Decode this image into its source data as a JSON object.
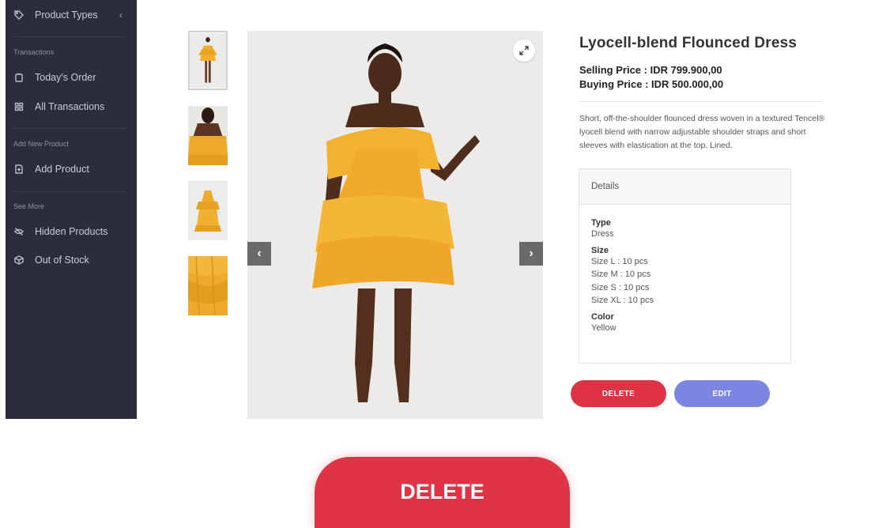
{
  "sidebar": {
    "product_types": "Product Types",
    "sections": {
      "transactions": "Transactions",
      "add_new_product": "Add New Product",
      "see_more": "See More"
    },
    "items": {
      "todays_order": "Today's Order",
      "all_transactions": "All Transactions",
      "add_product": "Add Product",
      "hidden_products": "Hidden Products",
      "out_of_stock": "Out of Stock"
    },
    "chevron": "‹"
  },
  "gallery": {
    "prev": "‹",
    "next": "›",
    "thumbnail_count": 4
  },
  "product": {
    "title": "Lyocell-blend Flounced Dress",
    "selling_price": "Selling Price : IDR 799.900,00",
    "buying_price": "Buying Price : IDR 500.000,00",
    "description": "Short, off-the-shoulder flounced dress woven in a textured Tencel® lyocell blend with narrow adjustable shoulder straps and short sleeves with elastication at the top. Lined.",
    "details": {
      "header": "Details",
      "type_label": "Type",
      "type_value": "Dress",
      "size_label": "Size",
      "sizes": [
        "Size L : 10 pcs",
        "Size M : 10 pcs",
        "Size S : 10 pcs",
        "Size XL : 10 pcs"
      ],
      "color_label": "Color",
      "color_value": "Yellow"
    }
  },
  "actions": {
    "delete": "DELETE",
    "edit": "EDIT",
    "zoomed_delete": "DELETE"
  },
  "colors": {
    "sidebar_bg": "#2b2d3c",
    "delete": "#dd3344",
    "edit": "#7b86e2",
    "dress": "#f2b12e"
  }
}
